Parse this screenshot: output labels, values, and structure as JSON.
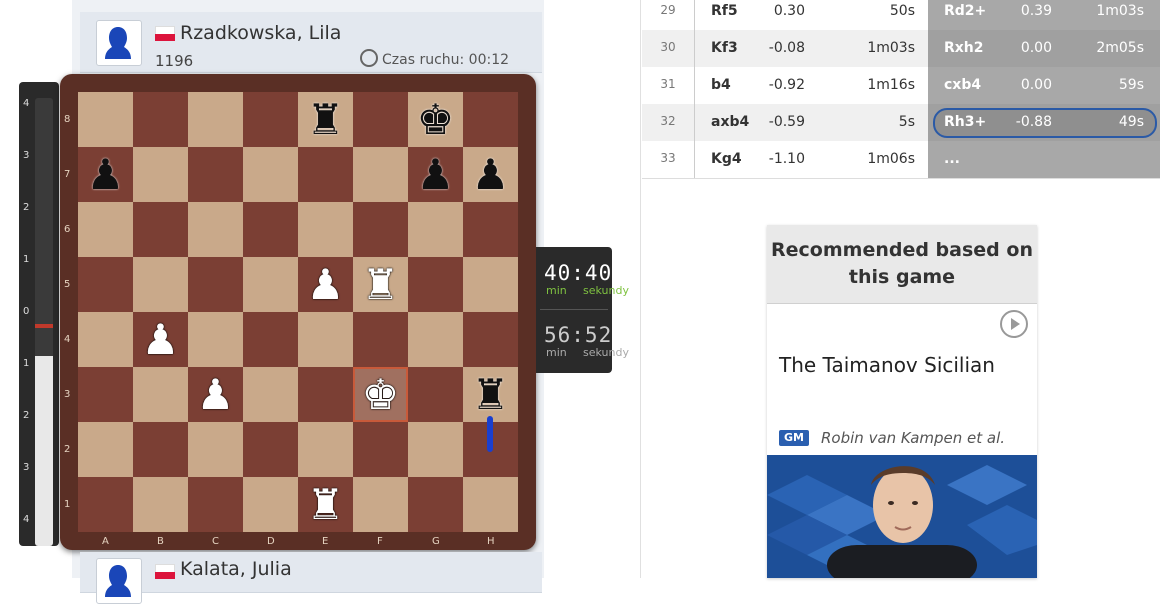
{
  "top_player": {
    "name": "Rzadkowska, Lila",
    "rating": "1196",
    "move_time_label": "Czas ruchu: 00:12"
  },
  "bottom_player": {
    "name": "Kalata, Julia"
  },
  "eval_labels": [
    "4",
    "3",
    "2",
    "1",
    "0",
    "1",
    "2",
    "3",
    "4"
  ],
  "board": {
    "files": [
      "A",
      "B",
      "C",
      "D",
      "E",
      "F",
      "G",
      "H"
    ],
    "ranks": [
      "8",
      "7",
      "6",
      "5",
      "4",
      "3",
      "2",
      "1"
    ],
    "rows": [
      [
        "",
        "",
        "",
        "",
        "bR",
        "",
        "bK",
        ""
      ],
      [
        "bP",
        "",
        "",
        "",
        "",
        "",
        "bP",
        "bP"
      ],
      [
        "",
        "",
        "",
        "",
        "",
        "",
        "",
        ""
      ],
      [
        "",
        "",
        "",
        "",
        "wP",
        "wR",
        "",
        ""
      ],
      [
        "",
        "wP",
        "",
        "",
        "",
        "",
        "",
        ""
      ],
      [
        "",
        "",
        "wP",
        "",
        "",
        "wK",
        "",
        "bR"
      ],
      [
        "",
        "",
        "",
        "",
        "",
        "",
        "",
        ""
      ],
      [
        "",
        "",
        "",
        "",
        "wR",
        "",
        "",
        ""
      ]
    ]
  },
  "timers": {
    "top": {
      "time": "40:40",
      "min": "min",
      "sec": "sekundy"
    },
    "bottom": {
      "time": "56:52",
      "min": "min",
      "sec": "sekundy"
    },
    "colors": {
      "active_min": "#7fc241",
      "active_sec": "#7fc241",
      "inactive": "#aaaaaa"
    }
  },
  "moves": [
    {
      "num": "29",
      "white": "Rf5",
      "white_eval": "0.30",
      "white_time": "50s",
      "black": "Rd2+",
      "black_eval": "0.39",
      "black_time": "1m03s"
    },
    {
      "num": "30",
      "white": "Kf3",
      "white_eval": "-0.08",
      "white_time": "1m03s",
      "black": "Rxh2",
      "black_eval": "0.00",
      "black_time": "2m05s"
    },
    {
      "num": "31",
      "white": "b4",
      "white_eval": "-0.92",
      "white_time": "1m16s",
      "black": "cxb4",
      "black_eval": "0.00",
      "black_time": "59s"
    },
    {
      "num": "32",
      "white": "axb4",
      "white_eval": "-0.59",
      "white_time": "5s",
      "black": "Rh3+",
      "black_eval": "-0.88",
      "black_time": "49s"
    },
    {
      "num": "33",
      "white": "Kg4",
      "white_eval": "-1.10",
      "white_time": "1m06s",
      "black": "...",
      "black_eval": "",
      "black_time": ""
    }
  ],
  "recommendation": {
    "header": "Recommended based on this game",
    "title": "The Taimanov Sicilian",
    "badge": "GM",
    "author": "Robin van Kampen et al."
  }
}
